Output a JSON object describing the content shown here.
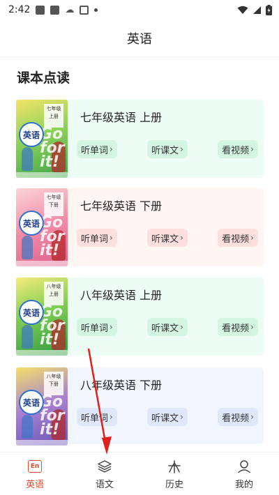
{
  "status_bar": {
    "time": "2:42"
  },
  "header": {
    "title": "英语"
  },
  "section": {
    "title": "课本点读"
  },
  "books": [
    {
      "title": "七年级英语 上册",
      "cover_badge": "英语",
      "cover_text": "Go for it!",
      "cover_label": "七年级 上册",
      "buttons": [
        "听单词",
        "听课文",
        "看视频"
      ]
    },
    {
      "title": "七年级英语 下册",
      "cover_badge": "英语",
      "cover_text": "Go for it!",
      "cover_label": "七年级 下册",
      "buttons": [
        "听单词",
        "听课文",
        "看视频"
      ]
    },
    {
      "title": "八年级英语 上册",
      "cover_badge": "英语",
      "cover_text": "Go for it!",
      "cover_label": "八年级 上册",
      "buttons": [
        "听单词",
        "听课文",
        "看视频"
      ]
    },
    {
      "title": "八年级英语 下册",
      "cover_badge": "英语",
      "cover_text": "Go for it!",
      "cover_label": "八年级 下册",
      "buttons": [
        "听单词",
        "听课文",
        "看视频"
      ]
    }
  ],
  "tabs": [
    {
      "label": "英语",
      "icon": "en-icon",
      "active": true
    },
    {
      "label": "语文",
      "icon": "layers-icon",
      "active": false
    },
    {
      "label": "历史",
      "icon": "history-icon",
      "active": false
    },
    {
      "label": "我的",
      "icon": "user-icon",
      "active": false
    }
  ],
  "colors": {
    "accent": "#e24a2c",
    "arrow": "#e0201a"
  }
}
